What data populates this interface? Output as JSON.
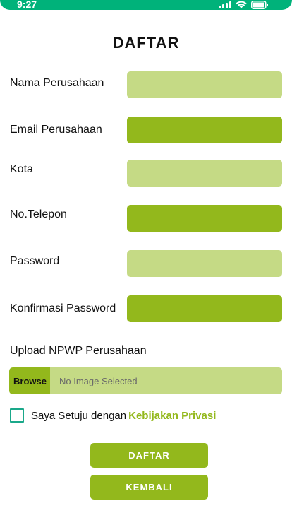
{
  "status_bar": {
    "time": "9:27",
    "icons": [
      "signal-icon",
      "wifi-icon",
      "battery-icon"
    ],
    "color": "#00b27a"
  },
  "page": {
    "title": "DAFTAR"
  },
  "form": {
    "fields": [
      {
        "label": "Nama Perusahaan",
        "value": "",
        "color": "#c5da85"
      },
      {
        "label": "Email Perusahaan",
        "value": "",
        "color": "#93b81c"
      },
      {
        "label": "Kota",
        "value": "",
        "color": "#c5da85"
      },
      {
        "label": "No.Telepon",
        "value": "",
        "color": "#93b81c"
      },
      {
        "label": "Password",
        "value": "",
        "color": "#c5da85"
      },
      {
        "label": "Konfirmasi Password",
        "value": "",
        "color": "#93b81c"
      }
    ],
    "upload": {
      "label": "Upload NPWP Perusahaan",
      "browse_label": "Browse",
      "status": "No Image Selected"
    },
    "agreement": {
      "checked": false,
      "text": "Saya Setuju dengan",
      "link": "Kebijakan Privasi"
    }
  },
  "buttons": {
    "register": "DAFTAR",
    "back": "KEMBALI"
  },
  "colors": {
    "accent": "#93b81c",
    "accent_light": "#c5da85",
    "checkbox_border": "#1aa88a"
  }
}
